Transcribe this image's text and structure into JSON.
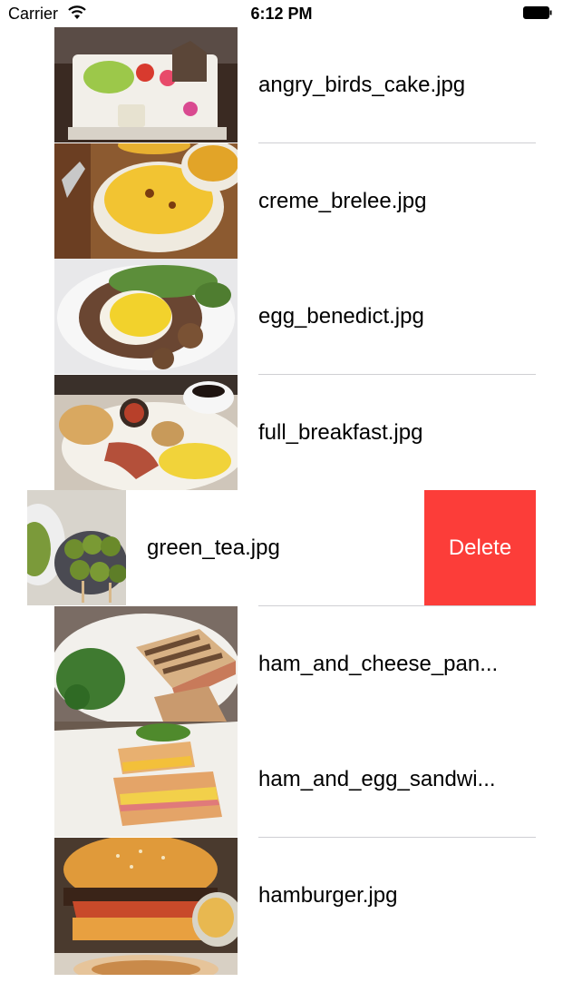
{
  "status": {
    "carrier": "Carrier",
    "time": "6:12 PM"
  },
  "rows": [
    {
      "label": "angry_birds_cake.jpg",
      "icon": "cake-photo"
    },
    {
      "label": "creme_brelee.jpg",
      "icon": "creme-brulee-photo"
    },
    {
      "label": "egg_benedict.jpg",
      "icon": "egg-benedict-photo"
    },
    {
      "label": "full_breakfast.jpg",
      "icon": "breakfast-photo"
    },
    {
      "label": "green_tea.jpg",
      "icon": "green-tea-photo"
    },
    {
      "label": "ham_and_cheese_pan...",
      "icon": "panini-photo"
    },
    {
      "label": "ham_and_egg_sandwi...",
      "icon": "sandwich-photo"
    },
    {
      "label": "hamburger.jpg",
      "icon": "hamburger-photo"
    }
  ],
  "delete_label": "Delete",
  "colors": {
    "delete": "#fc3d39",
    "separator": "#cfcfd3"
  }
}
